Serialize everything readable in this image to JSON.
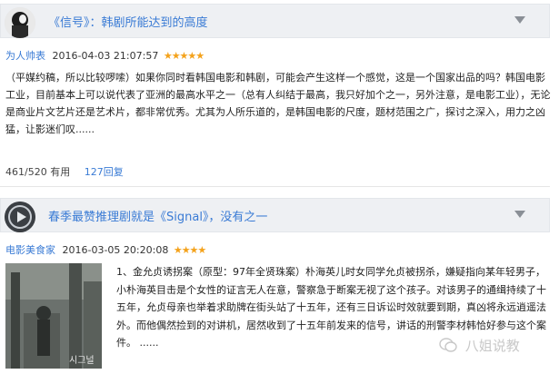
{
  "reviews": [
    {
      "title": "《信号》：韩剧所能达到的高度",
      "user": "为人帅表",
      "date": "2016-04-03 21:07:57",
      "stars": "★★★★★",
      "rating": 5,
      "body": "（平媒约稿，所以比较啰嗦）如果你同时看韩国电影和韩剧，可能会产生这样一个感觉，这是一个国家出品的吗？韩国电影工业，目前基本上可以说代表了亚洲的最高水平之一（总有人纠结于最高，我只好加个之一，另外注意，是电影工业），无论是商业片文艺片还是艺术片，都非常优秀。尤其为人所乐道的，是韩国电影的尺度，题材范围之广，探讨之深入，用力之凶猛，让影迷们叹......",
      "more": "......",
      "useful": "461/520 有用",
      "replies": "127回复"
    },
    {
      "title": "春季最赞推理剧就是《Signal》，没有之一",
      "user": "电影美食家",
      "date": "2016-03-05 20:20:08",
      "stars": "★★★★",
      "rating": 4,
      "body": "1、金允贞诱拐案（原型：97年全贤珠案）朴海英儿时女同学允贞被拐杀，嫌疑指向某年轻男子，小朴海英目击是个女性的证言无人在意，警察急于断案无视了这个孩子。对该男子的通缉持续了十五年，允贞母亲也举着求助牌在街头站了十五年，还有三日诉讼时效就要到期，真凶将永远逍遥法外。而他偶然捡到的对讲机，居然收到了十五年前发来的信号，讲话的刑警李材韩恰好参与这个案件。 ......",
      "poster_text": "시그널"
    }
  ],
  "watermark": "八姐说教"
}
